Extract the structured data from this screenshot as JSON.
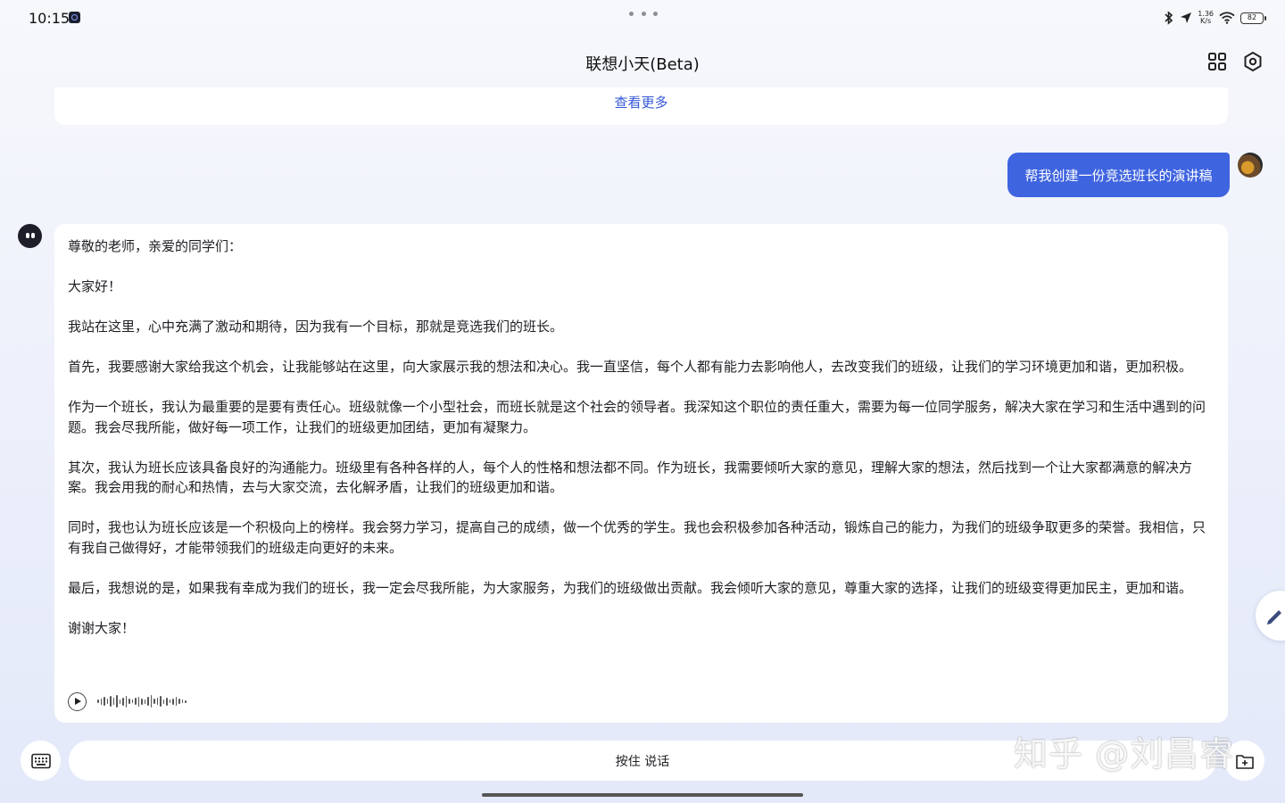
{
  "status_bar": {
    "time": "10:15",
    "net_speed_value": "1.36",
    "net_speed_unit": "K/s",
    "battery": "82"
  },
  "header": {
    "title": "联想小天(Beta)",
    "apps_icon": "grid-icon",
    "settings_icon": "gear-icon"
  },
  "previous_card": {
    "see_more": "查看更多"
  },
  "user_message": {
    "text": "帮我创建一份竞选班长的演讲稿"
  },
  "assistant_message": {
    "paragraphs": [
      "尊敬的老师，亲爱的同学们：",
      "大家好！",
      "我站在这里，心中充满了激动和期待，因为我有一个目标，那就是竞选我们的班长。",
      "首先，我要感谢大家给我这个机会，让我能够站在这里，向大家展示我的想法和决心。我一直坚信，每个人都有能力去影响他人，去改变我们的班级，让我们的学习环境更加和谐，更加积极。",
      "作为一个班长，我认为最重要的是要有责任心。班级就像一个小型社会，而班长就是这个社会的领导者。我深知这个职位的责任重大，需要为每一位同学服务，解决大家在学习和生活中遇到的问题。我会尽我所能，做好每一项工作，让我们的班级更加团结，更加有凝聚力。",
      "其次，我认为班长应该具备良好的沟通能力。班级里有各种各样的人，每个人的性格和想法都不同。作为班长，我需要倾听大家的意见，理解大家的想法，然后找到一个让大家都满意的解决方案。我会用我的耐心和热情，去与大家交流，去化解矛盾，让我们的班级更加和谐。",
      "同时，我也认为班长应该是一个积极向上的榜样。我会努力学习，提高自己的成绩，做一个优秀的学生。我也会积极参加各种活动，锻炼自己的能力，为我们的班级争取更多的荣誉。我相信，只有我自己做得好，才能带领我们的班级走向更好的未来。",
      "最后，我想说的是，如果我有幸成为我们的班长，我一定会尽我所能，为大家服务，为我们的班级做出贡献。我会倾听大家的意见，尊重大家的选择，让我们的班级变得更加民主，更加和谐。",
      "谢谢大家！"
    ],
    "audio_icon": "play-icon"
  },
  "input_bar": {
    "hold_to_talk": "按住 说话",
    "keyboard_icon": "keyboard-icon",
    "add_icon": "add-file-icon"
  },
  "watermark": {
    "zhihu": "知乎 @刘昌睿"
  },
  "colors": {
    "accent": "#3f64e0",
    "link": "#3558d8",
    "background_top": "#f7f8fc",
    "background_bottom": "#e3e9f9"
  }
}
